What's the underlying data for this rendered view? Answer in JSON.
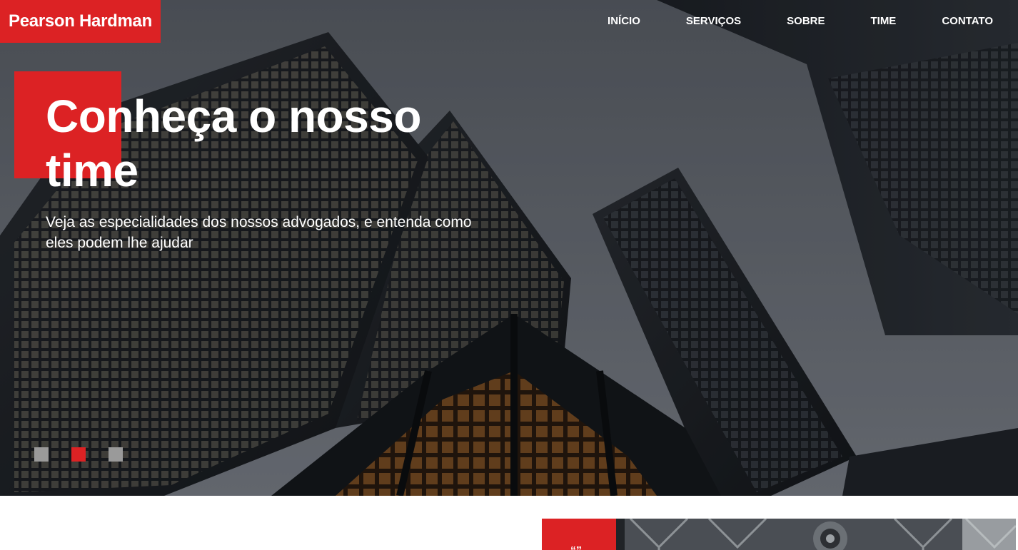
{
  "brand": {
    "name": "Pearson Hardman",
    "accent": "#dc2224"
  },
  "nav": {
    "items": [
      {
        "label": "INÍCIO"
      },
      {
        "label": "SERVIÇOS"
      },
      {
        "label": "SOBRE"
      },
      {
        "label": "TIME"
      },
      {
        "label": "CONTATO"
      }
    ]
  },
  "hero": {
    "title": "Conheça o nosso time",
    "subtitle": "Veja as especialidades dos nossos advogados, e entenda como eles podem lhe ajudar",
    "background": "skyscrapers-photo",
    "slides": {
      "count": 3,
      "active_index": 1
    }
  },
  "team_section": {
    "badge_icon": "quote-icon",
    "badge_text": "“”",
    "photo": "team-photo"
  }
}
